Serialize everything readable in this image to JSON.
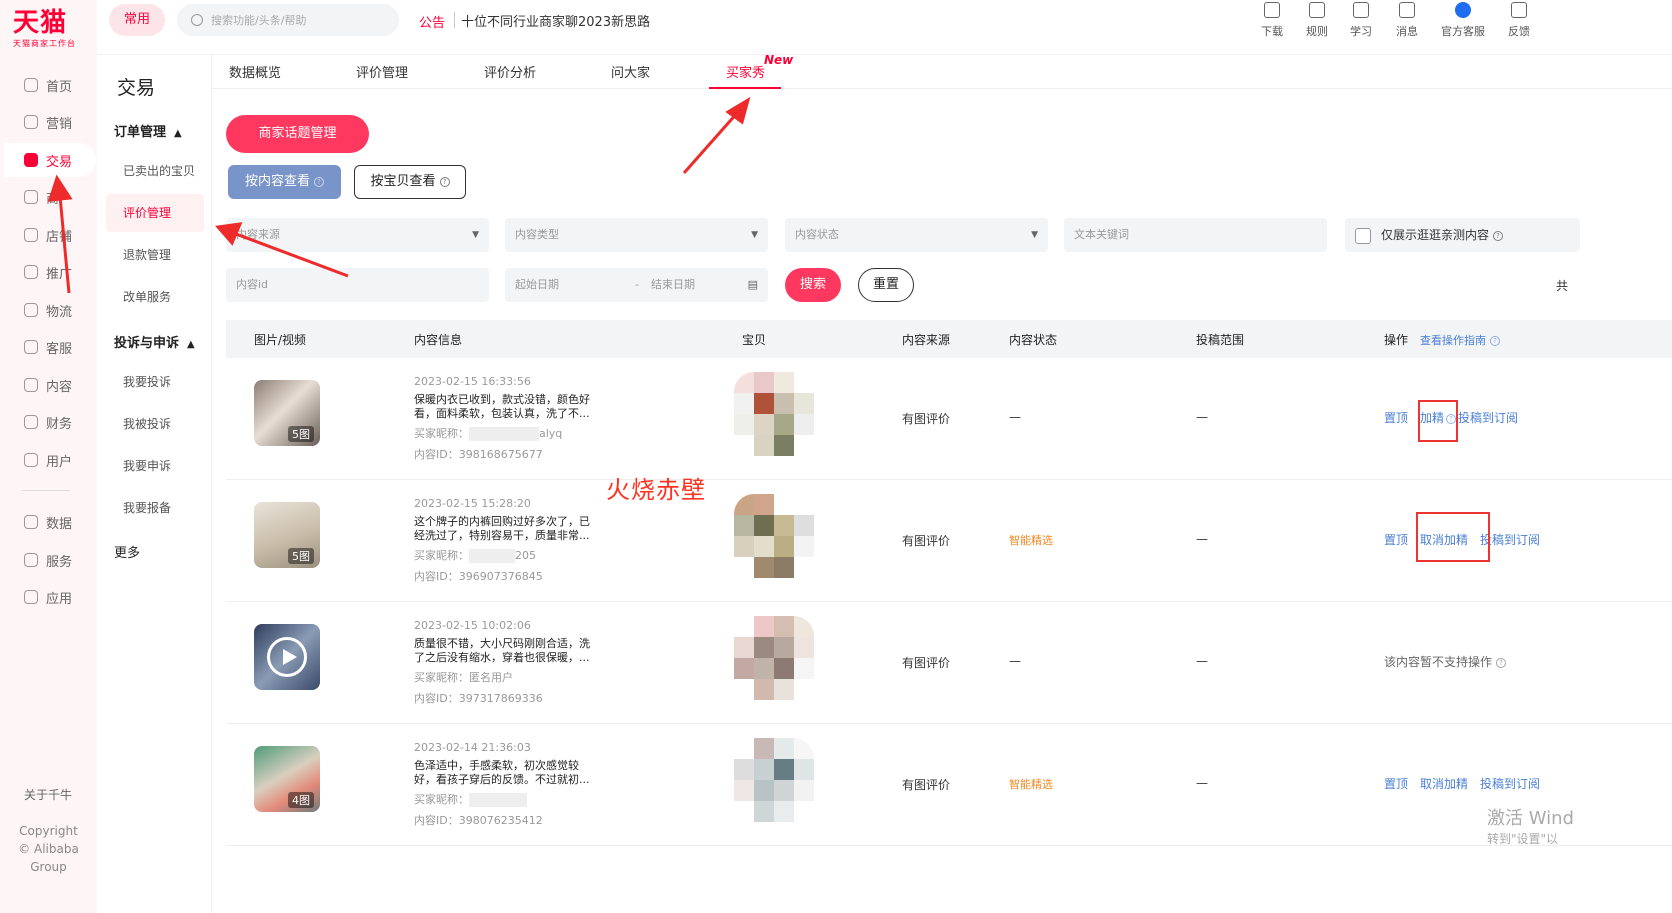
{
  "brand": {
    "logo_main": "天猫",
    "logo_sub": "天猫商家工作台"
  },
  "rail": {
    "items": [
      {
        "label": "首页",
        "icon": "home-icon"
      },
      {
        "label": "营销",
        "icon": "megaphone-icon"
      },
      {
        "label": "交易",
        "icon": "trade-icon",
        "active": true
      },
      {
        "label": "商",
        "icon": "goods-icon"
      },
      {
        "label": "店铺",
        "icon": "store-icon"
      },
      {
        "label": "推广",
        "icon": "location-icon"
      },
      {
        "label": "物流",
        "icon": "truck-icon"
      },
      {
        "label": "客服",
        "icon": "headset-icon"
      },
      {
        "label": "内容",
        "icon": "content-icon"
      },
      {
        "label": "财务",
        "icon": "finance-icon"
      },
      {
        "label": "用户",
        "icon": "user-icon"
      },
      {
        "label": "数据",
        "icon": "data-icon"
      },
      {
        "label": "服务",
        "icon": "service-icon"
      },
      {
        "label": "应用",
        "icon": "apps-icon"
      }
    ],
    "about": "关于千牛",
    "copyright": "Copyright",
    "copyright2": "© Alibaba Group"
  },
  "topbar": {
    "freq": "常用",
    "search_placeholder": "搜索功能/头条/帮助",
    "notice_label": "公告",
    "notice_text": "十位不同行业商家聊2023新思路",
    "tools": [
      {
        "label": "下载",
        "icon": "download-icon"
      },
      {
        "label": "规则",
        "icon": "rules-icon"
      },
      {
        "label": "学习",
        "icon": "learn-icon"
      },
      {
        "label": "消息",
        "icon": "message-icon"
      },
      {
        "label": "官方客服",
        "icon": "official-service-icon"
      },
      {
        "label": "反馈",
        "icon": "feedback-icon"
      }
    ]
  },
  "side2": {
    "title": "交易",
    "group1": "订单管理",
    "items1": [
      "已卖出的宝贝",
      "评价管理",
      "退款管理",
      "改单服务"
    ],
    "group2": "投诉与申诉",
    "items2": [
      "我要投诉",
      "我被投诉",
      "我要申诉",
      "我要报备"
    ],
    "more": "更多"
  },
  "tabs": {
    "items": [
      "数据概览",
      "评价管理",
      "评价分析",
      "问大家",
      "买家秀"
    ],
    "new_badge": "New"
  },
  "actions": {
    "topic": "商家话题管理",
    "view_content": "按内容查看",
    "view_item": "按宝贝查看"
  },
  "filters": {
    "source": "内容来源",
    "type": "内容类型",
    "status": "内容状态",
    "keyword": "文本关键词",
    "only_show": "仅展示逛逛亲测内容",
    "content_id": "内容id",
    "start_date": "起始日期",
    "end_date": "结束日期",
    "date_sep": "-",
    "search": "搜索",
    "reset": "重置",
    "total": "共"
  },
  "table": {
    "headers": [
      "图片/视频",
      "内容信息",
      "宝贝",
      "内容来源",
      "内容状态",
      "投稿范围",
      "操作"
    ],
    "guide": "查看操作指南",
    "rows": [
      {
        "ts": "2023-02-15 16:33:56",
        "text": "保暖内衣已收到，款式没错，颜色好看，面料柔软，包装认真，洗了不...",
        "nick_label": "买家昵称：",
        "nick": "alyq",
        "cid_label": "内容ID：",
        "cid": "398168675677",
        "count": "5图",
        "source": "有图评价",
        "status": "—",
        "scope": "—",
        "ops": [
          "置顶",
          "加精",
          "投稿到订阅"
        ]
      },
      {
        "ts": "2023-02-15 15:28:20",
        "text": "这个牌子的内裤回购过好多次了，已经洗过了，特别容易干，质量非常...",
        "nick_label": "买家昵称：",
        "nick": "205",
        "cid_label": "内容ID：",
        "cid": "396907376845",
        "count": "5图",
        "source": "有图评价",
        "status": "智能精选",
        "scope": "—",
        "ops": [
          "置顶",
          "取消加精",
          "投稿到订阅"
        ]
      },
      {
        "ts": "2023-02-15 10:02:06",
        "text": "质量很不错，大小尺码刚刚合适，洗了之后没有缩水，穿着也很保暖，...",
        "nick_label": "买家昵称：",
        "nick": "匿名用户",
        "cid_label": "内容ID：",
        "cid": "397317869336",
        "count": "",
        "source": "有图评价",
        "status": "—",
        "scope": "—",
        "ops_na": "该内容暂不支持操作"
      },
      {
        "ts": "2023-02-14 21:36:03",
        "text": "色泽适中，手感柔软，初次感觉较好，看孩子穿后的反馈。不过就初...",
        "nick_label": "买家昵称：",
        "nick": "",
        "cid_label": "内容ID：",
        "cid": "398076235412",
        "count": "4图",
        "source": "有图评价",
        "status": "智能精选",
        "scope": "—",
        "ops": [
          "置顶",
          "取消加精",
          "投稿到订阅"
        ]
      }
    ]
  },
  "overlay": {
    "watermark": "火烧赤壁",
    "win_activate": "激活 Wind",
    "win_sub": "转到\"设置\"以"
  },
  "colors": {
    "brand": "#ff0036",
    "primary_btn": "#ff3860",
    "link": "#4a7fd4",
    "smart": "#f08a24",
    "annotation": "#e33"
  }
}
